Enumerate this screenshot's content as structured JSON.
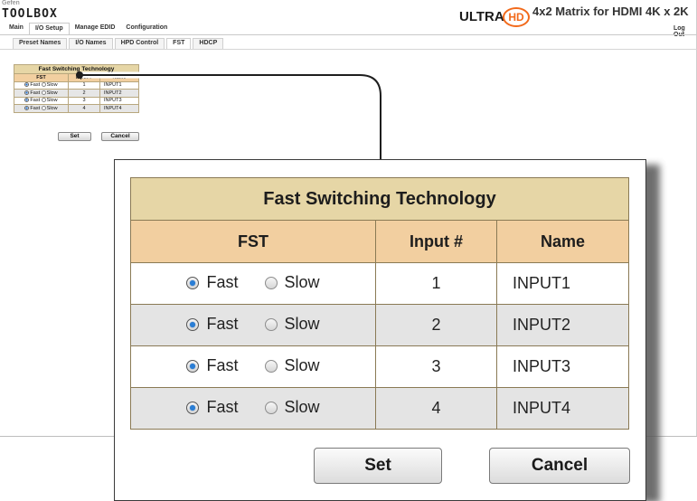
{
  "header": {
    "logo_small": "Gefen",
    "logo_big": "TOOLBOX",
    "brand_ultra": "ULTRA",
    "brand_hd": "HD",
    "product_title": "4x2 Matrix for HDMI 4K x 2K",
    "logout_label": "Log Out"
  },
  "main_tabs": [
    "Main",
    "I/O Setup",
    "Manage EDID",
    "Configuration"
  ],
  "main_tab_active": "I/O Setup",
  "sub_tabs": [
    "Preset Names",
    "I/O Names",
    "HPD Control",
    "FST",
    "HDCP"
  ],
  "sub_tab_active": "FST",
  "fst_table": {
    "title": "Fast Switching Technology",
    "columns": [
      "FST",
      "Input #",
      "Name"
    ],
    "option_fast": "Fast",
    "option_slow": "Slow",
    "rows": [
      {
        "mode": "Fast",
        "input": "1",
        "name": "INPUT1"
      },
      {
        "mode": "Fast",
        "input": "2",
        "name": "INPUT2"
      },
      {
        "mode": "Fast",
        "input": "3",
        "name": "INPUT3"
      },
      {
        "mode": "Fast",
        "input": "4",
        "name": "INPUT4"
      }
    ]
  },
  "buttons": {
    "set": "Set",
    "cancel": "Cancel"
  },
  "colors": {
    "title_bg": "#e6d6a6",
    "header_bg": "#f2cfa0",
    "alt_row_bg": "#e4e4e4",
    "radio_selected": "#2a7ed6",
    "hd_orange": "#f26a1b"
  }
}
